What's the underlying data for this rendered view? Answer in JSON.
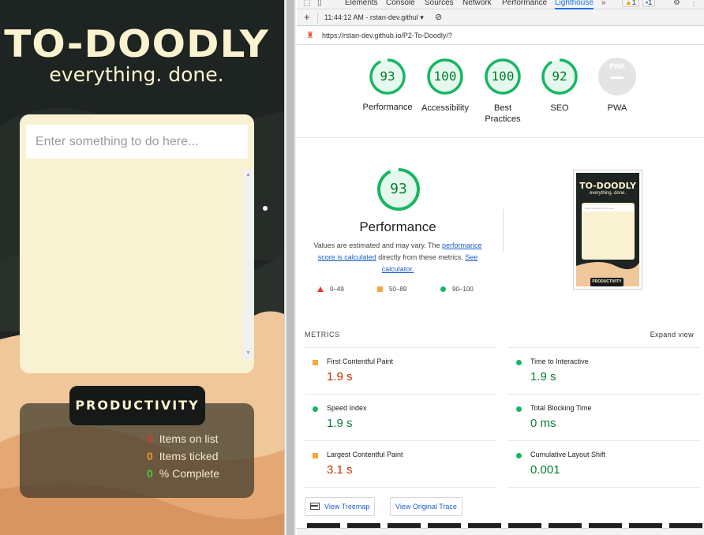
{
  "app": {
    "title": "TO-DOODLY",
    "tagline": "everything. done.",
    "input_placeholder": "Enter something to do here...",
    "productivity_label": "PRODUCTIVITY",
    "stats": [
      {
        "value": "0",
        "label": "Items on list"
      },
      {
        "value": "0",
        "label": "Items ticked"
      },
      {
        "value": "0",
        "label": "% Complete"
      }
    ],
    "colors": {
      "background": "#1e2421",
      "cream": "#fbf3cf",
      "sand": "#e9b98a"
    }
  },
  "devtools": {
    "tabs": [
      "Elements",
      "Console",
      "Sources",
      "Network",
      "Performance",
      "Lighthouse"
    ],
    "active_tab": "Lighthouse",
    "more_tabs": "»",
    "warning_count": "1",
    "message_count": "1",
    "toolbar": {
      "add": "+",
      "session": "11:44:12 AM - rstan-dev.githul ▾"
    },
    "report_url": "https://rstan-dev.github.io/P2-To-Doodly/?"
  },
  "scores": [
    {
      "value": "93",
      "label": "Performance",
      "fraction": 0.93
    },
    {
      "value": "100",
      "label": "Accessibility",
      "fraction": 1.0
    },
    {
      "value": "100",
      "label": "Best Practices",
      "fraction": 1.0
    },
    {
      "value": "92",
      "label": "SEO",
      "fraction": 0.92
    }
  ],
  "pwa": {
    "label": "PWA",
    "badge": "PWA"
  },
  "performance": {
    "score": "93",
    "fraction": 0.93,
    "title": "Performance",
    "desc_pre": "Values are estimated and may vary. The ",
    "desc_link1": "performance score is calculated",
    "desc_mid": " directly from these metrics. ",
    "desc_link2": "See calculator.",
    "legend": [
      "0–49",
      "50–89",
      "90–100"
    ]
  },
  "thumbnail": {
    "title": "TO-DOODLY",
    "tagline": "everything. done.",
    "placeholder": "Enter something to do here...",
    "badge": "PRODUCTIVITY"
  },
  "metrics": {
    "heading": "METRICS",
    "expand": "Expand view",
    "items": [
      {
        "name": "First Contentful Paint",
        "value": "1.9 s",
        "rating": "average"
      },
      {
        "name": "Time to Interactive",
        "value": "1.9 s",
        "rating": "pass"
      },
      {
        "name": "Speed Index",
        "value": "1.9 s",
        "rating": "pass"
      },
      {
        "name": "Total Blocking Time",
        "value": "0 ms",
        "rating": "pass"
      },
      {
        "name": "Largest Contentful Paint",
        "value": "3.1 s",
        "rating": "average"
      },
      {
        "name": "Cumulative Layout Shift",
        "value": "0.001",
        "rating": "pass"
      }
    ]
  },
  "buttons": {
    "treemap": "View Treemap",
    "trace": "View Original Trace"
  },
  "status_colors": {
    "pass": "#0a7d33",
    "average": "#c33300",
    "pass_ring": "#18b663"
  }
}
